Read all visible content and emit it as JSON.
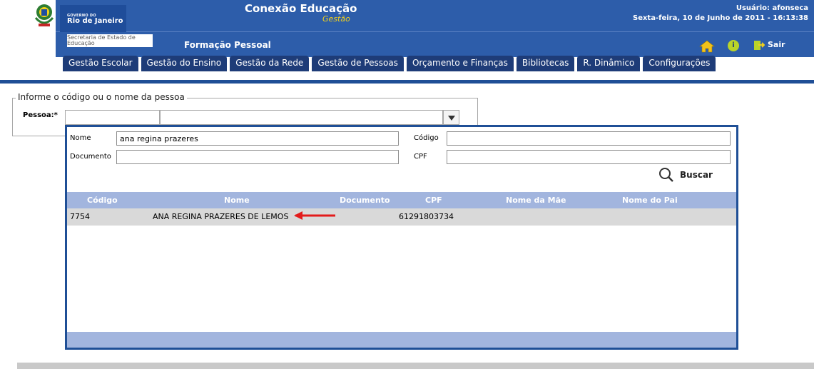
{
  "header": {
    "logo_gov": "GOVERNO DO",
    "logo_state": "Rio de Janeiro",
    "secretaria": "Secretaria de Estado de Educação",
    "app_title": "Conexão Educação",
    "app_subtitle": "Gestão",
    "module": "Formação Pessoal",
    "user": "Usuário: afonseca",
    "datetime": "Sexta-feira, 10 de Junho de 2011 - 16:13:38",
    "exit_label": "Sair",
    "icons": [
      "home-icon",
      "info-icon",
      "exit-icon"
    ],
    "colors": {
      "header_bg": "#2d5daa",
      "subtitle": "#f2d01c",
      "nav_tab": "#1e3c78"
    }
  },
  "nav": {
    "tabs": [
      "Gestão Escolar",
      "Gestão do Ensino",
      "Gestão da Rede",
      "Gestão de Pessoas",
      "Orçamento e Finanças",
      "Bibliotecas",
      "R. Dinâmico",
      "Configurações"
    ]
  },
  "form": {
    "legend": "Informe o código ou o nome da pessoa",
    "pessoa_label": "Pessoa:*",
    "code_value": "",
    "name_value": ""
  },
  "search": {
    "nome_label": "Nome",
    "nome_value": "ana regina prazeres",
    "codigo_label": "Código",
    "codigo_value": "",
    "documento_label": "Documento",
    "documento_value": "",
    "cpf_label": "CPF",
    "cpf_value": "",
    "buscar_label": "Buscar"
  },
  "results": {
    "columns": [
      "Código",
      "Nome",
      "Documento",
      "CPF",
      "Nome da Mãe",
      "Nome do Pai"
    ],
    "rows": [
      [
        "7754",
        "ANA REGINA PRAZERES DE LEMOS",
        "",
        "61291803734",
        "",
        ""
      ]
    ]
  }
}
